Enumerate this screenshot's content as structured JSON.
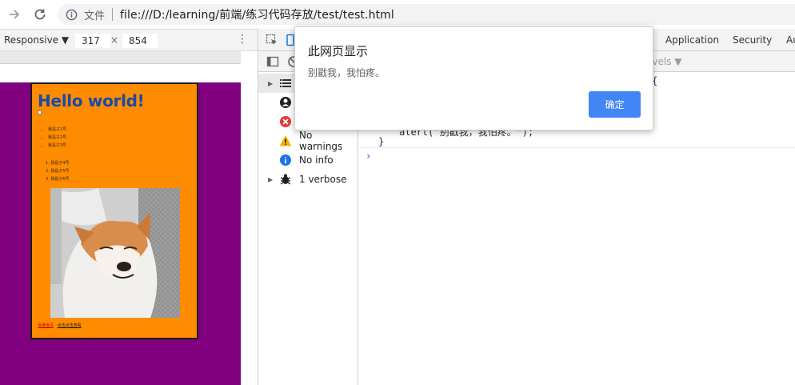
{
  "browser": {
    "security_label": "文件",
    "url": "file:///D:/learning/前端/练习代码存放/test/test.html"
  },
  "device_toolbar": {
    "mode": "Responsive ▼",
    "width": "317",
    "times": "×",
    "height": "854"
  },
  "page": {
    "heading": "Hello world!",
    "ul_items": [
      "我是子1号",
      "我是子2号",
      "我是子3号"
    ],
    "ol_items": [
      "1. 我是子4号",
      "2. 我是子5号",
      "3. 我是子6号"
    ],
    "link_red": "百度首页",
    "link_black": "点击点击查看",
    "background": "#800080",
    "card_color": "#ff8c00"
  },
  "devtools": {
    "tabs": [
      "Application",
      "Security",
      "Au"
    ],
    "levels_label": "evels ▼",
    "sidebar": [
      {
        "label": "",
        "icon": "list-icon"
      },
      {
        "label": "",
        "icon": "user-icon"
      },
      {
        "label": "",
        "icon": "error-icon"
      },
      {
        "label": "No warnings",
        "icon": "warning-icon"
      },
      {
        "label": "No info",
        "icon": "info-icon"
      },
      {
        "label": "1 verbose",
        "icon": "bug-icon"
      }
    ],
    "console_lines": [
      "{",
      "alert(\"别戳我，我怕疼。\");",
      "}"
    ],
    "prompt": "›"
  },
  "alert": {
    "title": "此网页显示",
    "message": "别戳我，我怕疼。",
    "ok_label": "确定",
    "ok_color": "#4285f4"
  }
}
